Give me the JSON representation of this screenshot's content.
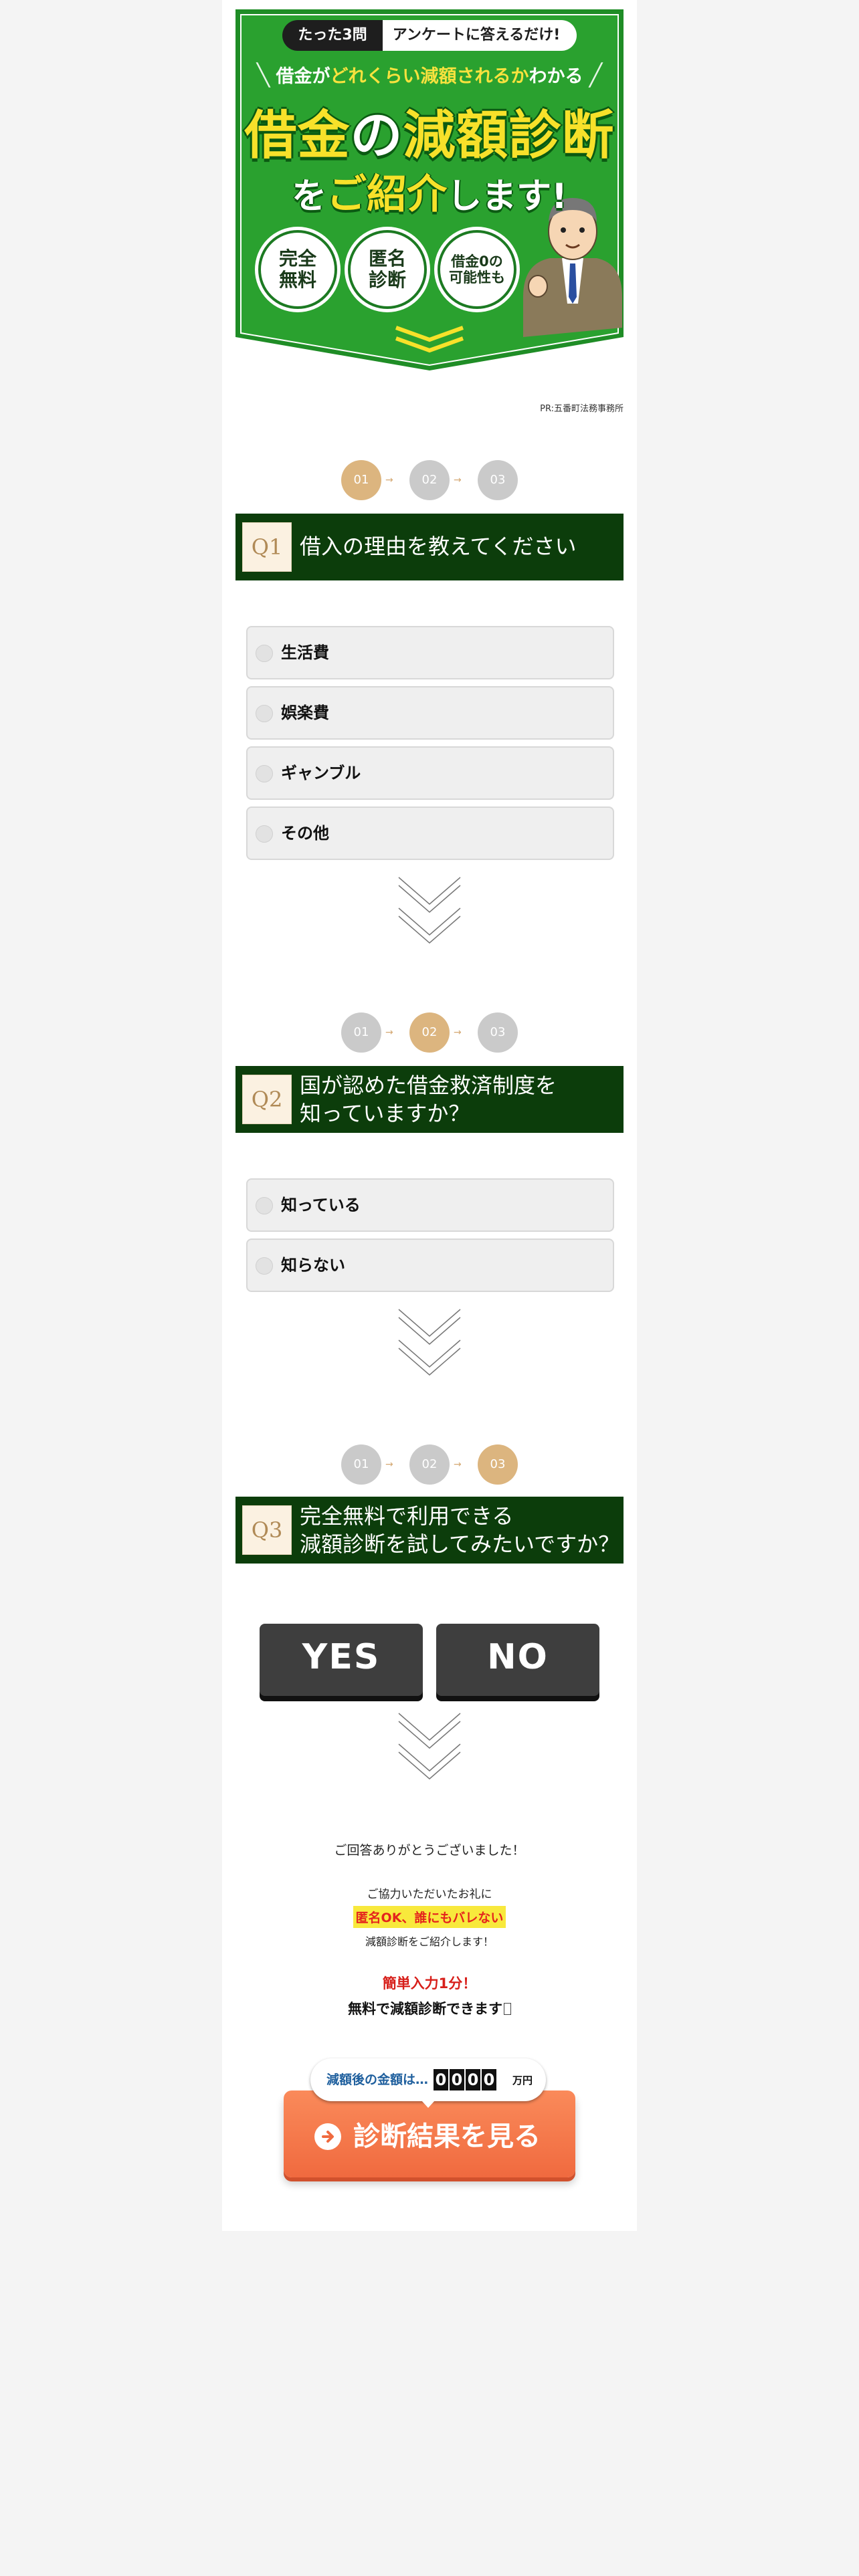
{
  "hero": {
    "pill_count": "たった3問",
    "pill_rest": "アンケートに答えるだけ!",
    "subtitle_pre": "借金が",
    "subtitle_hl": "どれくらい減額されるか",
    "subtitle_post": "わかる",
    "title_a": "借金",
    "title_b": "の",
    "title_c": "減額診断",
    "title2_a": "を",
    "title2_b": "ご紹介",
    "title2_c": "します!",
    "badges": [
      "完全\n無料",
      "匿名\n診断",
      "借金0の\n可能性も"
    ]
  },
  "pr_label": "PR:五番町法務事務所",
  "steps": [
    "01",
    "02",
    "03"
  ],
  "step_arrow": "→",
  "q1": {
    "icon": "Q1",
    "text": "借入の理由を教えてください",
    "options": [
      "生活費",
      "娯楽費",
      "ギャンブル",
      "その他"
    ]
  },
  "q2": {
    "icon": "Q2",
    "line1": "国が認めた借金救済制度を",
    "line2": "知っていますか？",
    "options": [
      "知っている",
      "知らない"
    ]
  },
  "q3": {
    "icon": "Q3",
    "line1": "完全無料で利用できる",
    "line2": "減額診断を試してみたいですか？",
    "yes": "YES",
    "no": "NO"
  },
  "thanks": {
    "line1": "ご回答ありがとうございました！",
    "line2": "ご協力いただいたお礼に",
    "highlight": "匿名OK、誰にもバレない",
    "line3": "減額診断をご紹介します！",
    "red": "簡単入力1分！",
    "line4": "無料で減額診断できます"
  },
  "cta": {
    "bubble_label": "減額後の金額は…",
    "digits": [
      "0",
      "0",
      "0",
      "0"
    ],
    "unit": "万円",
    "button_label": "診断結果を見る"
  },
  "colors": {
    "hero_green": "#2aa12f",
    "header_green": "#0c3d0b",
    "step_active": "#dcb57f",
    "step_inactive": "#cacaca",
    "cta_orange": "#f47a4d",
    "highlight_yellow": "#f8e93c",
    "alert_red": "#d71f1a"
  }
}
